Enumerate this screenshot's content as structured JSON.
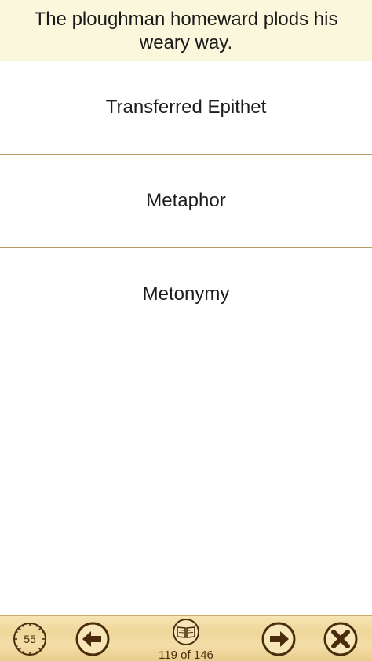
{
  "question": {
    "text": "The ploughman homeward plods his weary way."
  },
  "options": [
    {
      "label": "Transferred Epithet"
    },
    {
      "label": "Metaphor"
    },
    {
      "label": "Metonymy"
    }
  ],
  "toolbar": {
    "timer_value": "55",
    "progress": "119 of 146",
    "icons": {
      "timer": "timer-icon",
      "back": "arrow-left-icon",
      "book": "book-icon",
      "next": "arrow-right-icon",
      "close": "close-icon"
    }
  },
  "colors": {
    "question_bg": "#fbf7dc",
    "divider": "#b99a62",
    "toolbar_bg": "#efd79a",
    "icon_brown": "#4a2c0c"
  }
}
